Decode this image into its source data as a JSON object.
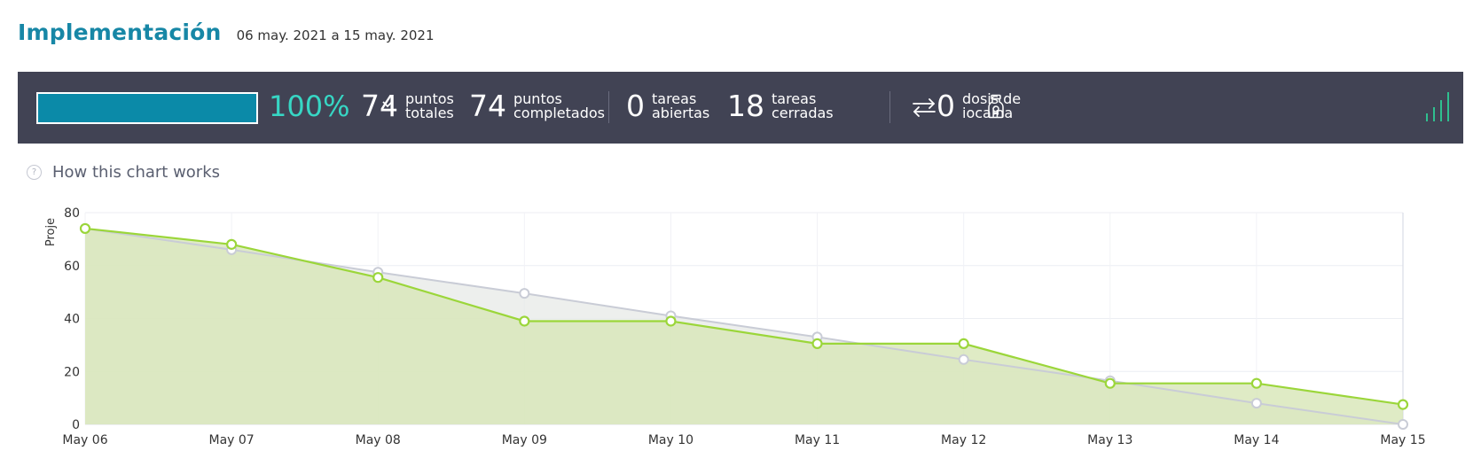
{
  "header": {
    "title": "Implementación",
    "date_range": "06 may. 2021 a 15 may. 2021"
  },
  "stats": {
    "progress_fraction": 1.0,
    "percent_label": "100%",
    "total_points_value": "74",
    "total_points_label_1": "puntos",
    "total_points_label_2": "totales",
    "completed_points_value": "74",
    "completed_points_label_1": "puntos",
    "completed_points_label_2": "completados",
    "open_tasks_value": "0",
    "open_tasks_label_1": "tareas",
    "open_tasks_label_2": "abiertas",
    "closed_tasks_value": "18",
    "closed_tasks_label_1": "tareas",
    "closed_tasks_label_2": "cerradas",
    "iocaine_value": "0",
    "iocaine_label_1": "dosis de",
    "iocaine_label_2": "iocaína",
    "icons": [
      "chevron-down-icon",
      "swap-arrows-icon",
      "potion-bottle-icon",
      "signal-bars-icon"
    ],
    "colors": {
      "bar_bg": "#414354",
      "progress": "#0b8aa8",
      "percent": "#37d6c4",
      "signal": "#2fbf8f"
    }
  },
  "how_chart_works": "How this chart works",
  "chart_data": {
    "type": "area",
    "ylabel": "Proje",
    "ylim": [
      0,
      80
    ],
    "yticks": [
      "0",
      "20",
      "40",
      "60",
      "80"
    ],
    "categories": [
      "May 06",
      "May 07",
      "May 08",
      "May 09",
      "May 10",
      "May 11",
      "May 12",
      "May 13",
      "May 14",
      "May 15"
    ],
    "series": [
      {
        "values": [
          74,
          66,
          57.5,
          49.5,
          41,
          33,
          24.5,
          16.5,
          8,
          0
        ],
        "color": "#c9ccd6"
      },
      {
        "values": [
          74,
          68,
          55.5,
          39,
          39,
          30.5,
          30.5,
          15.5,
          15.5,
          7.5
        ],
        "color": "#9bd63a"
      }
    ],
    "grid": true
  }
}
